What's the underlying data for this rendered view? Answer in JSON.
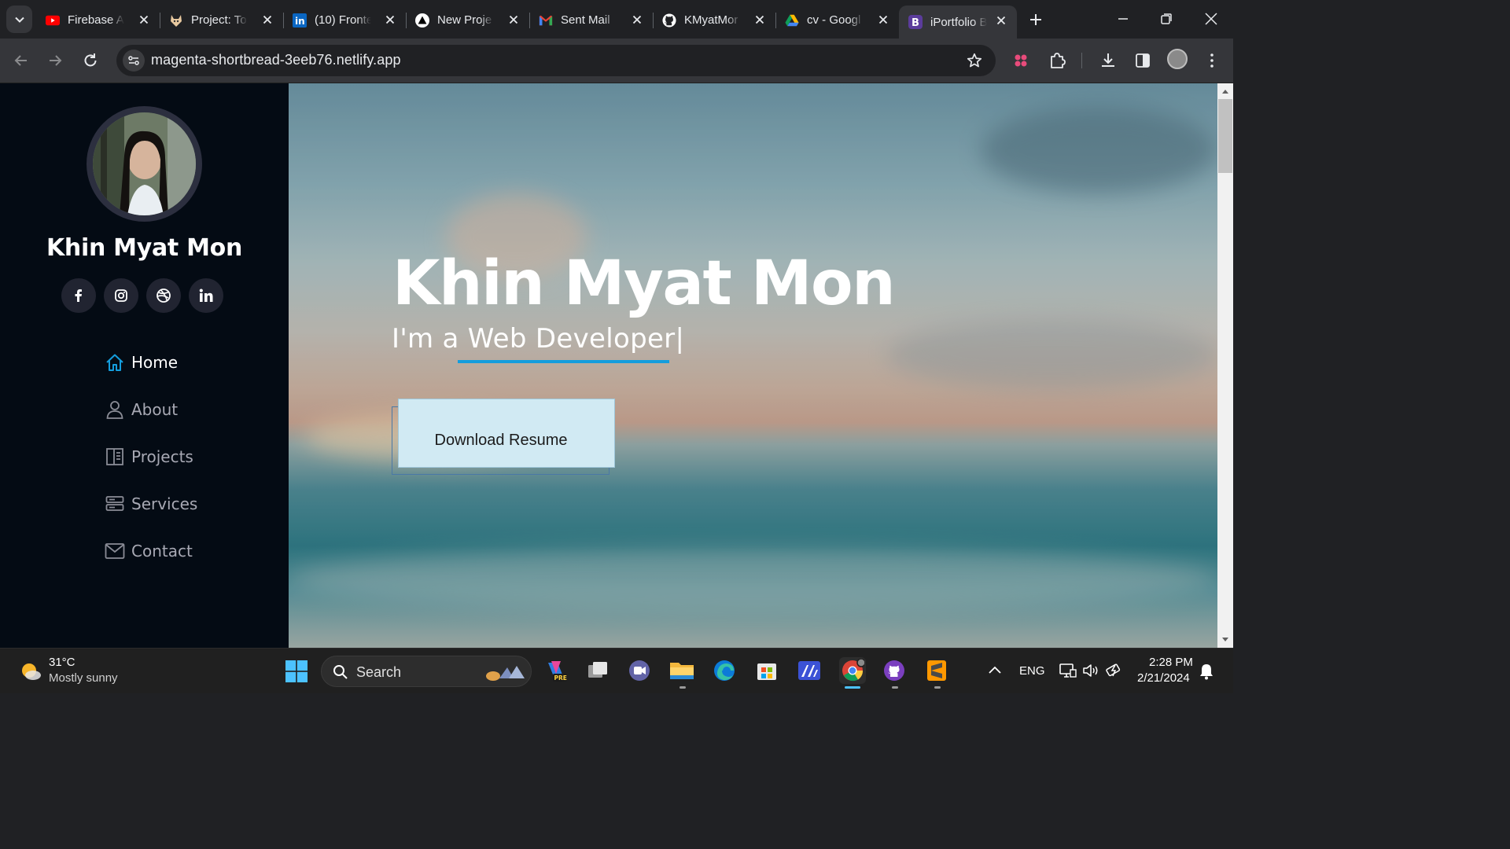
{
  "browser": {
    "tabs": [
      {
        "title": "Firebase A",
        "favicon": "youtube-icon"
      },
      {
        "title": "Project: To",
        "favicon": "gitlab-fox-icon"
      },
      {
        "title": "(10) Fronte",
        "favicon": "linkedin-icon"
      },
      {
        "title": "New Proje",
        "favicon": "vercel-triangle-icon"
      },
      {
        "title": "Sent Mail",
        "favicon": "gmail-icon"
      },
      {
        "title": "KMyatMor",
        "favicon": "github-icon"
      },
      {
        "title": "cv - Googl",
        "favicon": "google-drive-icon"
      },
      {
        "title": "iPortfolio B",
        "favicon": "bootstrap-icon",
        "active": true
      }
    ],
    "url": "magenta-shortbread-3eeb76.netlify.app"
  },
  "sidebar": {
    "name": "Khin Myat Mon",
    "social_icons": [
      "facebook-icon",
      "instagram-icon",
      "dribbble-icon",
      "linkedin-icon"
    ],
    "nav": [
      {
        "label": "Home",
        "icon": "home-icon",
        "active": true
      },
      {
        "label": "About",
        "icon": "person-icon"
      },
      {
        "label": "Projects",
        "icon": "file-richtext-icon"
      },
      {
        "label": "Services",
        "icon": "server-icon"
      },
      {
        "label": "Contact",
        "icon": "envelope-icon"
      }
    ]
  },
  "hero": {
    "title": "Khin Myat Mon",
    "subtitle": "I'm a Web Developer|",
    "download_button": "Download Resume",
    "accent_color": "#149ddd"
  },
  "taskbar": {
    "weather_temp": "31°C",
    "weather_desc": "Mostly sunny",
    "search_label": "Search",
    "language": "ENG",
    "time": "2:28 PM",
    "date": "2/21/2024"
  }
}
